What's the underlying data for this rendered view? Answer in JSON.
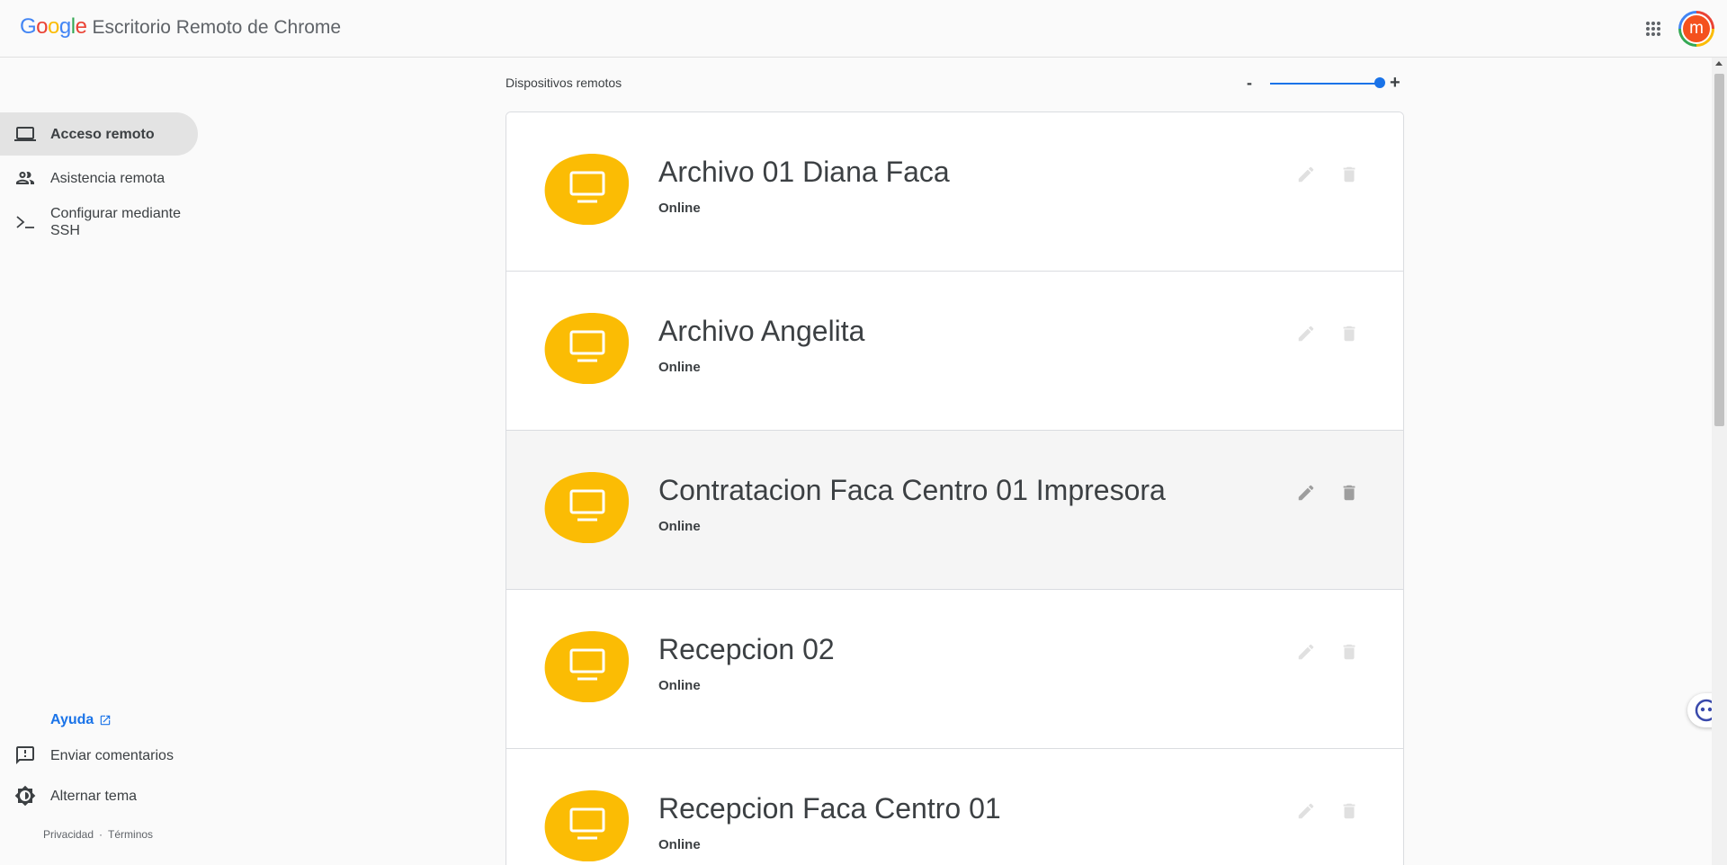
{
  "header": {
    "logo_text": "Google",
    "app_title": "Escritorio Remoto de Chrome",
    "apps_icon": "apps-grid-icon",
    "avatar_letter": "m"
  },
  "sidebar": {
    "items": [
      {
        "label": "Acceso remoto",
        "icon": "laptop-icon",
        "active": true
      },
      {
        "label": "Asistencia remota",
        "icon": "people-icon",
        "active": false
      },
      {
        "label": "Configurar mediante SSH",
        "icon": "terminal-icon",
        "active": false
      }
    ],
    "help_label": "Ayuda",
    "feedback_label": "Enviar comentarios",
    "theme_label": "Alternar tema",
    "privacy_label": "Privacidad",
    "separator": "·",
    "terms_label": "Términos"
  },
  "main": {
    "section_title": "Dispositivos remotos",
    "zoom_minus": "-",
    "zoom_plus": "+",
    "zoom_level": 1.0,
    "devices": [
      {
        "name": "Archivo 01 Diana Faca",
        "status": "Online"
      },
      {
        "name": "Archivo Angelita",
        "status": "Online"
      },
      {
        "name": "Contratacion Faca Centro 01 Impresora",
        "status": "Online"
      },
      {
        "name": "Recepcion 02",
        "status": "Online"
      },
      {
        "name": "Recepcion Faca Centro 01",
        "status": "Online"
      }
    ]
  },
  "colors": {
    "accent": "#1a73e8",
    "device_blob": "#fbbc04",
    "avatar_bg": "#f4511e"
  }
}
